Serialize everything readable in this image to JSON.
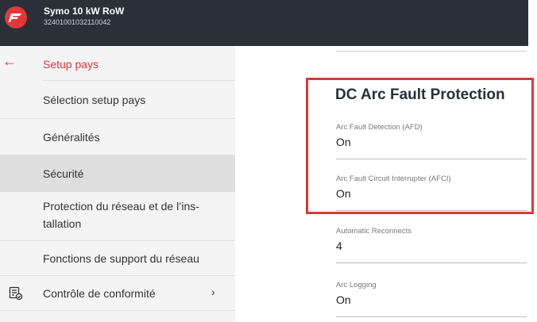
{
  "header": {
    "device_name": "Symo 10 kW RoW",
    "serial": "32401001032110042",
    "logo_icon": "fronius-logo-icon",
    "bg_color": "#2b2f38",
    "logo_color": "#e2373a"
  },
  "sidebar": {
    "back": {
      "icon": "arrow-left-icon",
      "label": "Setup pays"
    },
    "items": [
      {
        "label": "Sélection setup pays",
        "active": false
      },
      {
        "label": "Généralités",
        "active": false
      },
      {
        "label": "Sécurité",
        "active": true
      },
      {
        "label": "Protection du réseau et de l’ins-tallation",
        "active": false
      },
      {
        "label": "Fonctions de support du réseau",
        "active": false
      },
      {
        "label": "Contrôle de conformité",
        "icon": "checklist-icon",
        "chevron": "›",
        "active": false
      }
    ],
    "accent_color": "#d9393b"
  },
  "main": {
    "section_title": "DC Arc Fault Protection",
    "fields": [
      {
        "label": "Arc Fault Detection (AFD)",
        "value": "On"
      },
      {
        "label": "Arc Fault Circuit Interrupter (AFCI)",
        "value": "On"
      },
      {
        "label": "Automatic Reconnects",
        "value": "4"
      },
      {
        "label": "Arc Logging",
        "value": "On"
      }
    ],
    "highlight_color": "#d9393b"
  }
}
